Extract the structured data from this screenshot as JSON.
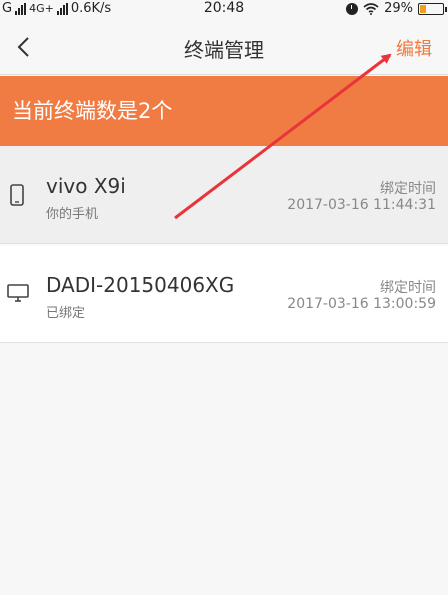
{
  "status_bar": {
    "carrier_left": "G",
    "network": "4G+",
    "speed": "0.6K/s",
    "time": "20:48",
    "battery_percent": "29%",
    "battery_level": 0.29
  },
  "nav": {
    "title": "终端管理",
    "edit_label": "编辑"
  },
  "banner": {
    "text": "当前终端数是2个"
  },
  "devices": [
    {
      "name": "vivo X9i",
      "subtitle": "你的手机",
      "bind_label": "绑定时间",
      "bind_time": "2017-03-16 11:44:31",
      "icon": "phone-icon"
    },
    {
      "name": "DADI-20150406XG",
      "subtitle": "已绑定",
      "bind_label": "绑定时间",
      "bind_time": "2017-03-16 13:00:59",
      "icon": "monitor-icon"
    }
  ],
  "colors": {
    "accent": "#f07c43",
    "annotation_arrow": "#e8343a"
  }
}
